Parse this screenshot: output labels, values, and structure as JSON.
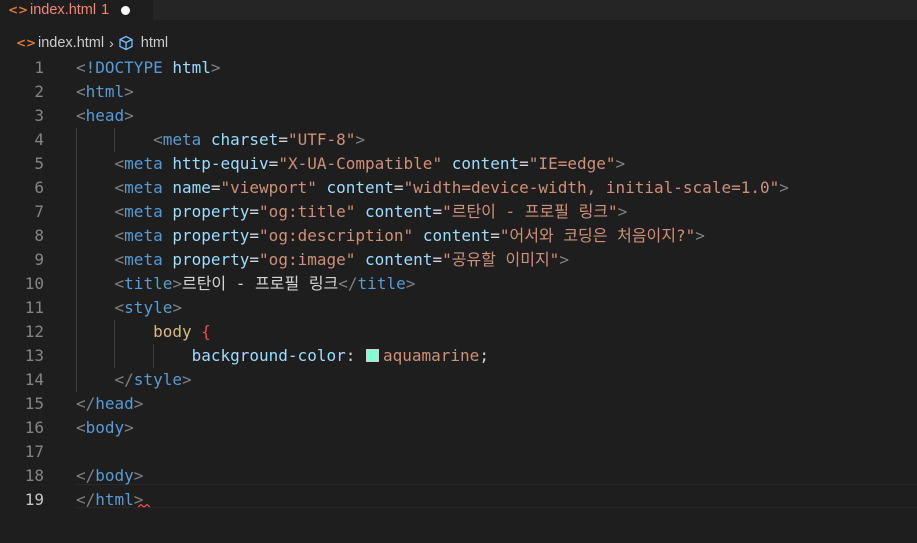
{
  "tab": {
    "icon": "html-file-icon",
    "label": "index.html",
    "problems_count": "1",
    "dirty": true
  },
  "breadcrumb": {
    "file_icon": "html-file-icon",
    "file": "index.html",
    "separator": "chevron-right-icon",
    "element_icon": "element-cube-icon",
    "element": "html"
  },
  "colors": {
    "editor_bg": "#1e1e1e",
    "tag_bracket": "#808080",
    "tag_name": "#569cd6",
    "attribute": "#9cdcfe",
    "string": "#ce9178",
    "selector": "#d7ba7d",
    "error": "#f44747",
    "swatch": "#7fffd4"
  },
  "editor": {
    "active_line": "19",
    "lines": [
      {
        "n": "1",
        "tokens": [
          [
            "tag",
            "<"
          ],
          [
            "name",
            "!DOCTYPE"
          ],
          [
            "text",
            " "
          ],
          [
            "attr",
            "html"
          ],
          [
            "tag",
            ">"
          ]
        ]
      },
      {
        "n": "2",
        "tokens": [
          [
            "tag",
            "<"
          ],
          [
            "name",
            "html"
          ],
          [
            "tag",
            ">"
          ]
        ]
      },
      {
        "n": "3",
        "tokens": [
          [
            "tag",
            "<"
          ],
          [
            "name",
            "head"
          ],
          [
            "tag",
            ">"
          ]
        ]
      },
      {
        "n": "4",
        "tokens": [
          [
            "text",
            "        "
          ],
          [
            "tag",
            "<"
          ],
          [
            "name",
            "meta"
          ],
          [
            "text",
            " "
          ],
          [
            "attr",
            "charset"
          ],
          [
            "text",
            "="
          ],
          [
            "val",
            "\"UTF-8\""
          ],
          [
            "tag",
            ">"
          ]
        ]
      },
      {
        "n": "5",
        "tokens": [
          [
            "text",
            "    "
          ],
          [
            "tag",
            "<"
          ],
          [
            "name",
            "meta"
          ],
          [
            "text",
            " "
          ],
          [
            "attr",
            "http-equiv"
          ],
          [
            "text",
            "="
          ],
          [
            "val",
            "\"X-UA-Compatible\""
          ],
          [
            "text",
            " "
          ],
          [
            "attr",
            "content"
          ],
          [
            "text",
            "="
          ],
          [
            "val",
            "\"IE=edge\""
          ],
          [
            "tag",
            ">"
          ]
        ]
      },
      {
        "n": "6",
        "tokens": [
          [
            "text",
            "    "
          ],
          [
            "tag",
            "<"
          ],
          [
            "name",
            "meta"
          ],
          [
            "text",
            " "
          ],
          [
            "attr",
            "name"
          ],
          [
            "text",
            "="
          ],
          [
            "val",
            "\"viewport\""
          ],
          [
            "text",
            " "
          ],
          [
            "attr",
            "content"
          ],
          [
            "text",
            "="
          ],
          [
            "val",
            "\"width=device-width, initial-scale=1.0\""
          ],
          [
            "tag",
            ">"
          ]
        ]
      },
      {
        "n": "7",
        "tokens": [
          [
            "text",
            "    "
          ],
          [
            "tag",
            "<"
          ],
          [
            "name",
            "meta"
          ],
          [
            "text",
            " "
          ],
          [
            "attr",
            "property"
          ],
          [
            "text",
            "="
          ],
          [
            "val",
            "\"og:title\""
          ],
          [
            "text",
            " "
          ],
          [
            "attr",
            "content"
          ],
          [
            "text",
            "="
          ],
          [
            "val",
            "\"르탄이 - 프로필 링크\""
          ],
          [
            "tag",
            ">"
          ]
        ]
      },
      {
        "n": "8",
        "tokens": [
          [
            "text",
            "    "
          ],
          [
            "tag",
            "<"
          ],
          [
            "name",
            "meta"
          ],
          [
            "text",
            " "
          ],
          [
            "attr",
            "property"
          ],
          [
            "text",
            "="
          ],
          [
            "val",
            "\"og:description\""
          ],
          [
            "text",
            " "
          ],
          [
            "attr",
            "content"
          ],
          [
            "text",
            "="
          ],
          [
            "val",
            "\"어서와 코딩은 처음이지?\""
          ],
          [
            "tag",
            ">"
          ]
        ]
      },
      {
        "n": "9",
        "tokens": [
          [
            "text",
            "    "
          ],
          [
            "tag",
            "<"
          ],
          [
            "name",
            "meta"
          ],
          [
            "text",
            " "
          ],
          [
            "attr",
            "property"
          ],
          [
            "text",
            "="
          ],
          [
            "val",
            "\"og:image\""
          ],
          [
            "text",
            " "
          ],
          [
            "attr",
            "content"
          ],
          [
            "text",
            "="
          ],
          [
            "val",
            "\"공유할 이미지\""
          ],
          [
            "tag",
            ">"
          ]
        ]
      },
      {
        "n": "10",
        "tokens": [
          [
            "text",
            "    "
          ],
          [
            "tag",
            "<"
          ],
          [
            "name",
            "title"
          ],
          [
            "tag",
            ">"
          ],
          [
            "text",
            "르탄이 - 프로필 링크"
          ],
          [
            "tag",
            "</"
          ],
          [
            "name",
            "title"
          ],
          [
            "tag",
            ">"
          ]
        ]
      },
      {
        "n": "11",
        "tokens": [
          [
            "text",
            "    "
          ],
          [
            "tag",
            "<"
          ],
          [
            "name",
            "style"
          ],
          [
            "tag",
            ">"
          ]
        ]
      },
      {
        "n": "12",
        "tokens": [
          [
            "text",
            "        "
          ],
          [
            "sel",
            "body"
          ],
          [
            "text",
            " "
          ],
          [
            "brace",
            "{"
          ]
        ]
      },
      {
        "n": "13",
        "tokens": [
          [
            "text",
            "            "
          ],
          [
            "prop",
            "background-color"
          ],
          [
            "text",
            ": "
          ],
          [
            "swatch",
            ""
          ],
          [
            "cssval",
            "aquamarine"
          ],
          [
            "text",
            ";"
          ]
        ]
      },
      {
        "n": "14",
        "tokens": [
          [
            "text",
            "    "
          ],
          [
            "tag",
            "</"
          ],
          [
            "name",
            "style"
          ],
          [
            "tag",
            ">"
          ]
        ]
      },
      {
        "n": "15",
        "tokens": [
          [
            "tag",
            "</"
          ],
          [
            "name",
            "head"
          ],
          [
            "tag",
            ">"
          ]
        ]
      },
      {
        "n": "16",
        "tokens": [
          [
            "tag",
            "<"
          ],
          [
            "name",
            "body"
          ],
          [
            "tag",
            ">"
          ]
        ]
      },
      {
        "n": "17",
        "tokens": []
      },
      {
        "n": "18",
        "tokens": [
          [
            "tag",
            "</"
          ],
          [
            "name",
            "body"
          ],
          [
            "tag",
            ">"
          ]
        ]
      },
      {
        "n": "19",
        "tokens": [
          [
            "tag",
            "</"
          ],
          [
            "name",
            "html"
          ],
          [
            "tag",
            ">"
          ]
        ]
      }
    ]
  }
}
